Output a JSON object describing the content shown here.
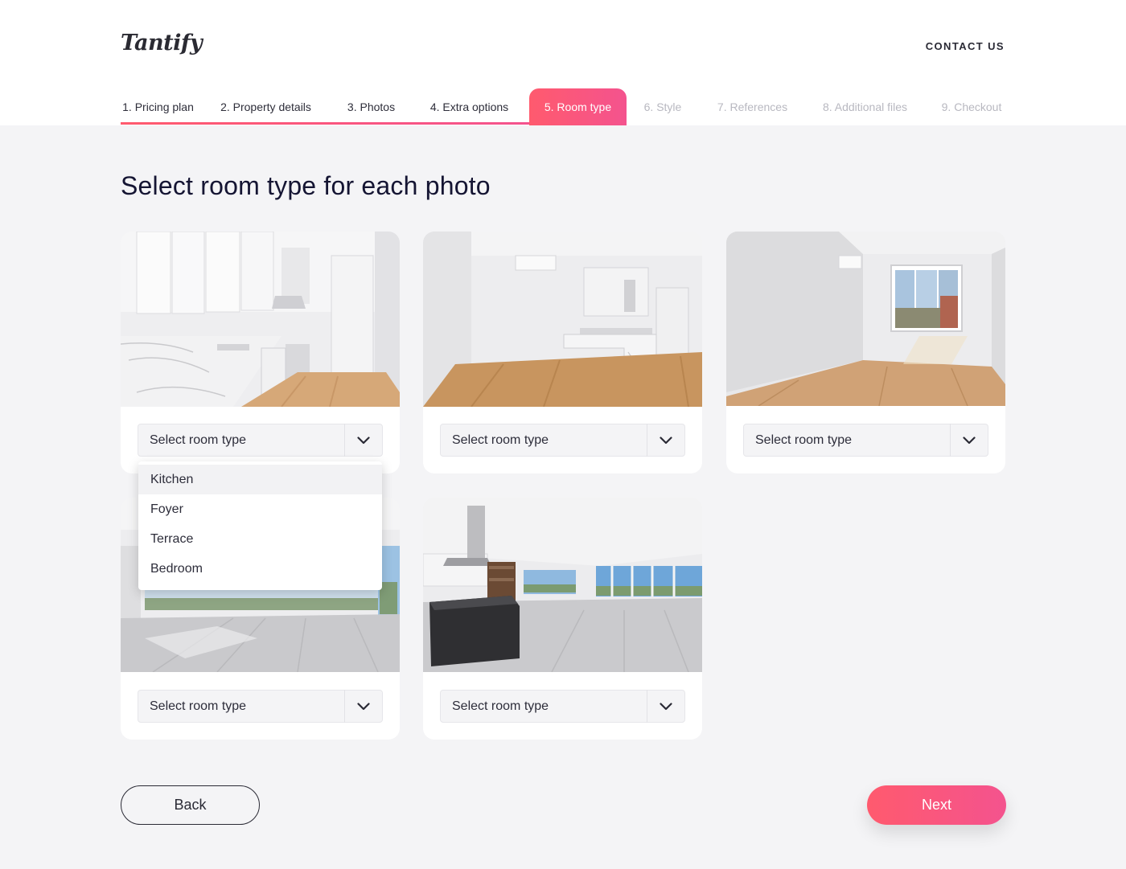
{
  "header": {
    "logo": "Tantify",
    "contact_label": "CONTACT US"
  },
  "steps": [
    {
      "label": "1. Pricing plan",
      "state": "done"
    },
    {
      "label": "2. Property details",
      "state": "done"
    },
    {
      "label": "3. Photos",
      "state": "done"
    },
    {
      "label": "4. Extra options",
      "state": "done"
    },
    {
      "label": "5. Room type",
      "state": "active"
    },
    {
      "label": "6. Style",
      "state": "future"
    },
    {
      "label": "7. References",
      "state": "future"
    },
    {
      "label": "8. Additional files",
      "state": "future"
    },
    {
      "label": "9. Checkout",
      "state": "future"
    }
  ],
  "main": {
    "title": "Select room type for each photo"
  },
  "photos": [
    {
      "select_label": "Select room type"
    },
    {
      "select_label": "Select room type"
    },
    {
      "select_label": "Select room type"
    },
    {
      "select_label": "Select room type"
    },
    {
      "select_label": "Select room type"
    }
  ],
  "dropdown": {
    "options": [
      "Kitchen",
      "Foyer",
      "Terrace",
      "Bedroom"
    ],
    "highlighted": "Kitchen"
  },
  "footer": {
    "back_label": "Back",
    "next_label": "Next"
  },
  "colors": {
    "accent_start": "#ff5a6e",
    "accent_end": "#f4538e",
    "background": "#f4f4f6"
  }
}
